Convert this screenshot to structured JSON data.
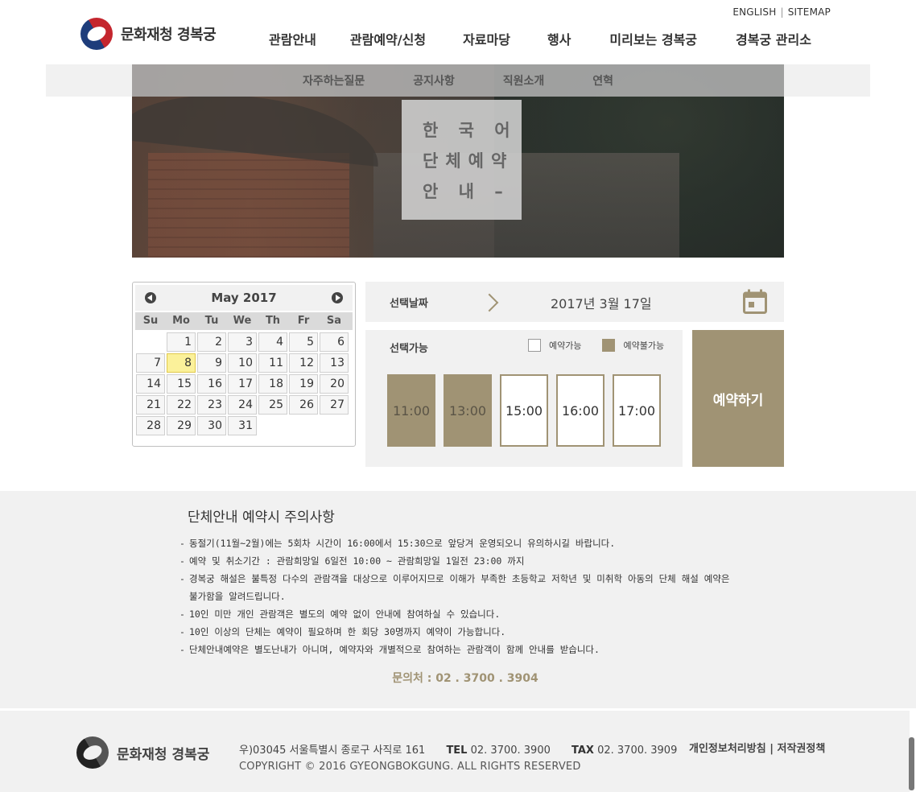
{
  "header": {
    "top_links": [
      "ENGLISH",
      "SITEMAP"
    ],
    "logo_text": "문화재청 경복궁",
    "nav": [
      "관람안내",
      "관람예약/신청",
      "자료마당",
      "행사",
      "미리보는 경복궁",
      "경복궁 관리소"
    ],
    "submenu": [
      "자주하는질문",
      "공지사항",
      "직원소개",
      "연혁"
    ]
  },
  "hero": {
    "lines": [
      "한 국 어",
      "단체예약",
      "안 내 –"
    ]
  },
  "calendar": {
    "month_label": "May 2017",
    "weekdays": [
      "Su",
      "Mo",
      "Tu",
      "We",
      "Th",
      "Fr",
      "Sa"
    ],
    "leading_blanks": 1,
    "days": [
      "1",
      "2",
      "3",
      "4",
      "5",
      "6",
      "7",
      "8",
      "9",
      "10",
      "11",
      "12",
      "13",
      "14",
      "15",
      "16",
      "17",
      "18",
      "19",
      "20",
      "21",
      "22",
      "23",
      "24",
      "25",
      "26",
      "27",
      "28",
      "29",
      "30",
      "31"
    ],
    "highlighted_day": "8"
  },
  "selection": {
    "date_label": "선택날짜",
    "date_value": "2017년 3월 17일",
    "avail_label": "선택가능",
    "legend_open": "예약가능",
    "legend_closed": "예약불가능",
    "slots": [
      {
        "time": "11:00",
        "status": "closed"
      },
      {
        "time": "13:00",
        "status": "closed"
      },
      {
        "time": "15:00",
        "status": "open"
      },
      {
        "time": "16:00",
        "status": "open"
      },
      {
        "time": "17:00",
        "status": "open"
      }
    ],
    "reserve_label": "예약하기"
  },
  "notice": {
    "title": "단체안내 예약시 주의사항",
    "items": [
      "동절기(11월~2월)에는 5회차 시간이 16:00에서 15:30으로 앞당겨 운영되오니 유의하시길 바랍니다.",
      "예약 및 취소기간 : 관람희망일 6일전 10:00 ~ 관람희망일 1일전 23:00 까지",
      "경복궁 해설은 불특정 다수의 관람객을 대상으로 이루어지므로 이해가 부족한 초등학교 저학년 및 미취학 아동의 단체 해설 예약은 불가함을 알려드립니다.",
      "10인 미만 개인 관람객은 별도의 예약 없이 안내에 참여하실 수 있습니다.",
      "10인 이상의 단체는 예약이 필요하며 한 회당 30명까지 예약이 가능합니다.",
      "단체안내예약은 별도난내가 아니며, 예약자와 개별적으로 참여하는 관람객이 함께 안내를 받습니다."
    ],
    "contact": "문의처 : 02 . 3700 . 3904"
  },
  "footer": {
    "logo_text": "문화재청 경복궁",
    "address": "우)03045 서울특별시 종로구 사직로 161",
    "tel_label": "TEL",
    "tel": "02. 3700. 3900",
    "fax_label": "TAX",
    "fax": "02. 3700. 3909",
    "copyright": "COPYRIGHT © 2016 GYEONGBOKGUNG. ALL RIGHTS RESERVED",
    "policy_links": [
      "개인정보처리방침",
      "저작권정책"
    ]
  },
  "colors": {
    "accent": "#a09374",
    "panel_bg": "#f1f1f1",
    "today_highlight": "#fbf19a"
  }
}
